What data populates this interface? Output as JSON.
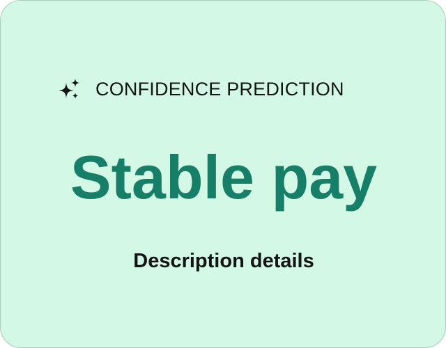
{
  "card": {
    "header": {
      "icon": "sparkle-icon",
      "label": "CONFIDENCE PREDICTION"
    },
    "prediction": "Stable pay",
    "description": "Description details"
  },
  "colors": {
    "background": "#d3f8e5",
    "border": "#a7cdb7",
    "accent": "#177e68",
    "text": "#141414"
  }
}
